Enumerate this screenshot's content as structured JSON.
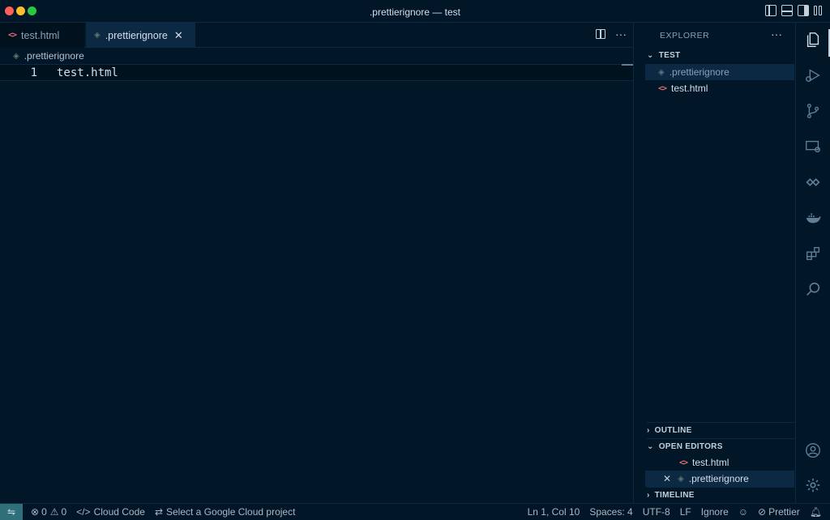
{
  "window": {
    "title": ".prettierignore — test"
  },
  "tabs": [
    {
      "label": "test.html",
      "icon": "html-icon"
    },
    {
      "label": ".prettierignore",
      "icon": "config-icon"
    }
  ],
  "editor_actions": {
    "split_icon": "split-editor-icon",
    "more": "···"
  },
  "breadcrumb": {
    "file": ".prettierignore"
  },
  "editor": {
    "lines": [
      {
        "number": "1",
        "text": "test.html"
      }
    ]
  },
  "sidebar": {
    "title": "EXPLORER",
    "more": "···",
    "folder": "TEST",
    "files": [
      {
        "name": ".prettierignore"
      },
      {
        "name": "test.html"
      }
    ],
    "outline": "OUTLINE",
    "open_editors": "OPEN EDITORS",
    "open_files": [
      {
        "name": "test.html"
      },
      {
        "name": ".prettierignore"
      }
    ],
    "timeline": "TIMELINE"
  },
  "statusbar": {
    "errors": "0",
    "warnings": "0",
    "cloud_code": "Cloud Code",
    "gcp_project": "Select a Google Cloud project",
    "cursor": "Ln 1, Col 10",
    "spaces": "Spaces: 4",
    "encoding": "UTF-8",
    "eol": "LF",
    "language": "Ignore",
    "prettier": "Prettier"
  },
  "colors": {
    "background": "#011627",
    "accent": "#2f6f7a",
    "html_icon": "#e06c6c"
  }
}
